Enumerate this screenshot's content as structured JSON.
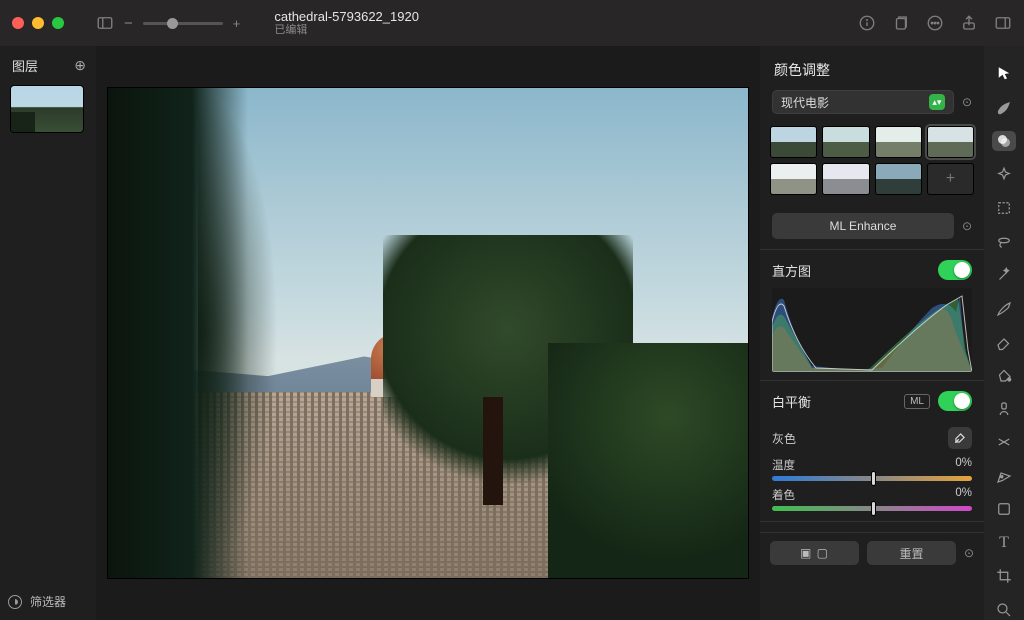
{
  "titlebar": {
    "doc_name": "cathedral-5793622_1920",
    "status": "已编辑"
  },
  "left": {
    "title": "图层",
    "filters": "筛选器"
  },
  "inspector": {
    "title": "颜色调整",
    "preset": "现代电影",
    "ml_enhance": "ML Enhance",
    "histogram": "直方图",
    "white_balance": "白平衡",
    "ml_badge": "ML",
    "gray": "灰色",
    "temperature_label": "温度",
    "temperature_value": "0%",
    "tint_label": "着色",
    "tint_value": "0%",
    "reset": "重置",
    "split": "◧□"
  },
  "tools": [
    "arrow",
    "brush-paint",
    "adjust",
    "sparkle",
    "marquee",
    "lasso",
    "color-picker",
    "paintbrush",
    "eraser",
    "gradient",
    "clone",
    "warp",
    "pen",
    "shape",
    "text",
    "crop",
    "zoom"
  ]
}
